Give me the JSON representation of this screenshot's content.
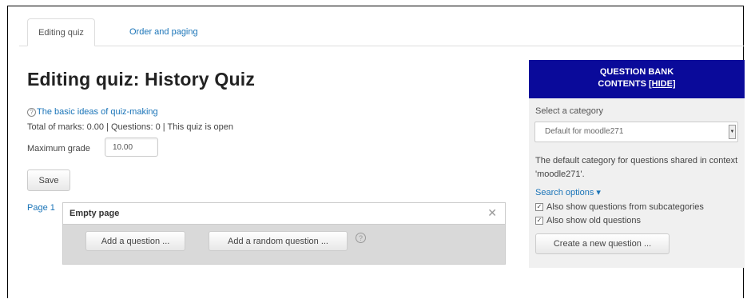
{
  "tabs": [
    {
      "label": "Editing quiz",
      "active": true
    },
    {
      "label": "Order and paging",
      "active": false
    }
  ],
  "page": {
    "title": "Editing quiz: History Quiz",
    "help_link": "The basic ideas of quiz-making",
    "totals": "Total of marks: 0.00 | Questions: 0 | This quiz is open",
    "max_grade_label": "Maximum grade",
    "max_grade_value": "10.00",
    "save_label": "Save"
  },
  "quiz_page": {
    "label": "Page 1",
    "empty_label": "Empty page",
    "close_glyph": "✕",
    "add_question": "Add a question ...",
    "add_random_question": "Add a random question ...",
    "help_glyph": "?"
  },
  "question_bank": {
    "header_line1": "QUESTION BANK",
    "header_line2": "CONTENTS",
    "hide_label": "[HIDE]",
    "select_label": "Select a category",
    "selected_category": "Default for moodle271",
    "description": "The default category for questions shared in context 'moodle271'.",
    "search_options": "Search options ▾",
    "option_subcategories": "Also show questions from subcategories",
    "option_old": "Also show old questions",
    "create_button": "Create a new question ...",
    "header_color": "#0a0a9a"
  },
  "icons": {
    "help": "help-icon",
    "close": "close-icon",
    "dropdown": "chevron-down-icon",
    "checkbox": "checkbox-icon"
  }
}
